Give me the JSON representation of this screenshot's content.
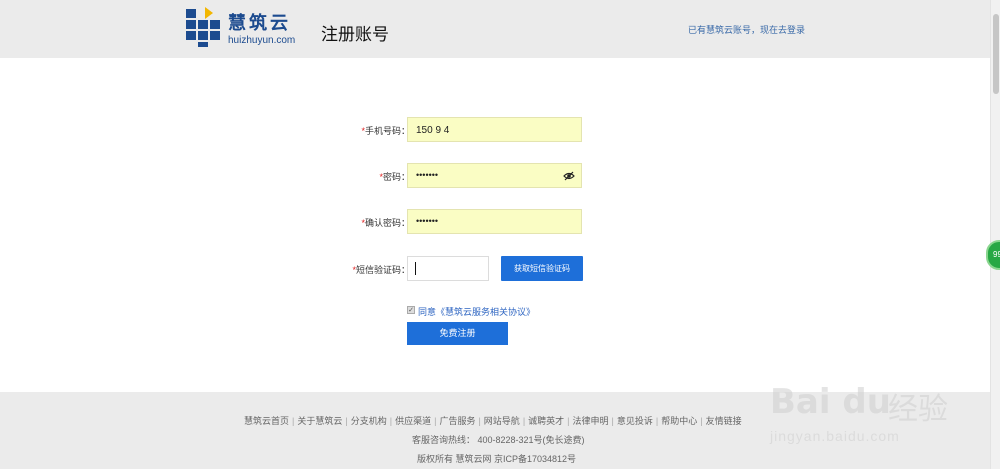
{
  "header": {
    "logo_cn": "慧筑云",
    "logo_en": "huizhuyun.com",
    "page_title": "注册账号",
    "login_link": "已有慧筑云账号，现在去登录"
  },
  "form": {
    "phone": {
      "label": "手机号码：",
      "required_mark": "*",
      "value": "150 9 4"
    },
    "password": {
      "label": "密码：",
      "required_mark": "*",
      "value": "•••••••"
    },
    "confirm": {
      "label": "确认密码：",
      "required_mark": "*",
      "value": "•••••••"
    },
    "sms": {
      "label": "短信验证码：",
      "required_mark": "*",
      "value": "",
      "button": "获取短信验证码"
    }
  },
  "agreement": {
    "checked": true,
    "text": "同意《慧筑云服务相关协议》"
  },
  "submit_label": "免费注册",
  "footer": {
    "links": [
      "慧筑云首页",
      "关于慧筑云",
      "分支机构",
      "供应渠道",
      "广告服务",
      "网站导航",
      "诚聘英才",
      "法律申明",
      "意见投诉",
      "帮助中心",
      "友情链接"
    ],
    "hotline": "客服咨询热线： 400-8228-321号(免长途费)",
    "copyright": "版权所有 慧筑云网 京ICP备17034812号"
  },
  "side_badge": "99",
  "watermark": {
    "logo": "Bai du",
    "cn": "经验",
    "url": "jingyan.baidu.com"
  },
  "colors": {
    "primary": "#1e6fd9",
    "brand": "#1c4b8f",
    "autofill": "#fafdc4",
    "required": "#e02020"
  }
}
